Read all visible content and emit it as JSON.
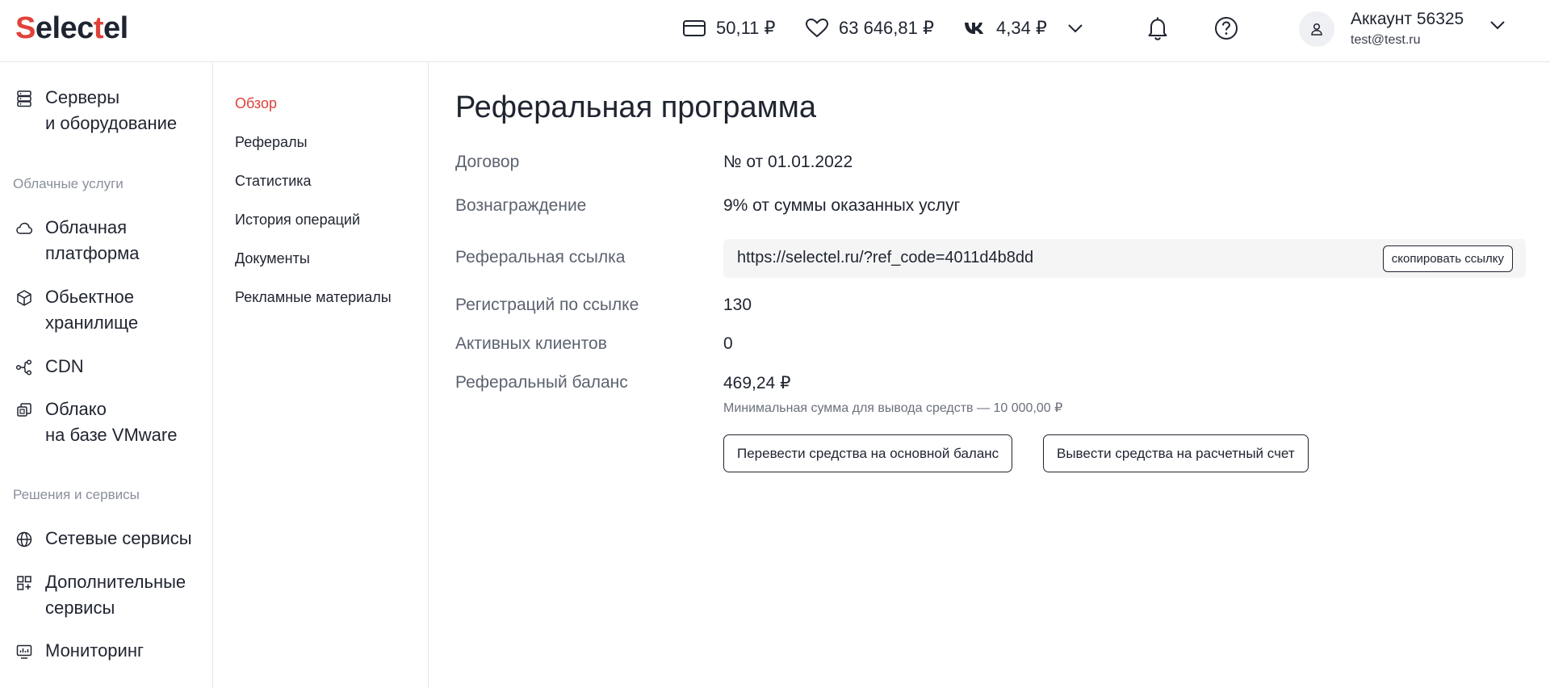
{
  "header": {
    "logo_text_a": "S",
    "logo_text_b": "elec",
    "logo_text_c": "t",
    "logo_text_d": "el",
    "balance_card": "50,11 ₽",
    "balance_bonus": "63 646,81 ₽",
    "balance_vk": "4,34 ₽",
    "account_name": "Аккаунт 56325",
    "account_email": "test@test.ru"
  },
  "sidebar": {
    "sections": [
      {
        "label": "Облачные услуги"
      },
      {
        "label": "Решения и сервисы"
      }
    ],
    "items": [
      {
        "label": "Серверы\nи оборудование",
        "icon": "server-icon"
      },
      {
        "label": "Облачная\nплатформа",
        "icon": "cloud-icon"
      },
      {
        "label": "Обьектное\nхранилище",
        "icon": "cube-icon"
      },
      {
        "label": "CDN",
        "icon": "cdn-icon"
      },
      {
        "label": "Облако\nна базе VMware",
        "icon": "vmware-icon"
      },
      {
        "label": "Сетевые сервисы",
        "icon": "globe-icon"
      },
      {
        "label": "Дополнительные\nсервисы",
        "icon": "apps-icon"
      },
      {
        "label": "Мониторинг",
        "icon": "monitor-icon"
      }
    ]
  },
  "subnav": {
    "items": [
      {
        "label": "Обзор",
        "active": true
      },
      {
        "label": "Рефералы"
      },
      {
        "label": "Статистика"
      },
      {
        "label": "История операций"
      },
      {
        "label": "Документы"
      },
      {
        "label": "Рекламные материалы"
      }
    ]
  },
  "main": {
    "title": "Реферальная программа",
    "rows": [
      {
        "label": "Договор",
        "value": "№ от 01.01.2022"
      },
      {
        "label": "Вознаграждение",
        "value": "9% от суммы оказанных услуг"
      },
      {
        "label": "Реферальная ссылка",
        "value": "https://selectel.ru/?ref_code=4011d4b8dd"
      },
      {
        "label": "Регистраций по ссылке",
        "value": "130"
      },
      {
        "label": "Активных клиентов",
        "value": "0"
      },
      {
        "label": "Реферальный баланс",
        "value": "469,24 ₽"
      }
    ],
    "copy_button": "скопировать ссылку",
    "min_hint": "Минимальная сумма для вывода средств — 10 000,00 ₽",
    "transfer_button": "Перевести средства на основной баланс",
    "withdraw_button": "Вывести средства на расчетный счет"
  },
  "colors": {
    "accent": "#e0413a",
    "text": "#1f2430",
    "muted": "#8a8f9b"
  }
}
